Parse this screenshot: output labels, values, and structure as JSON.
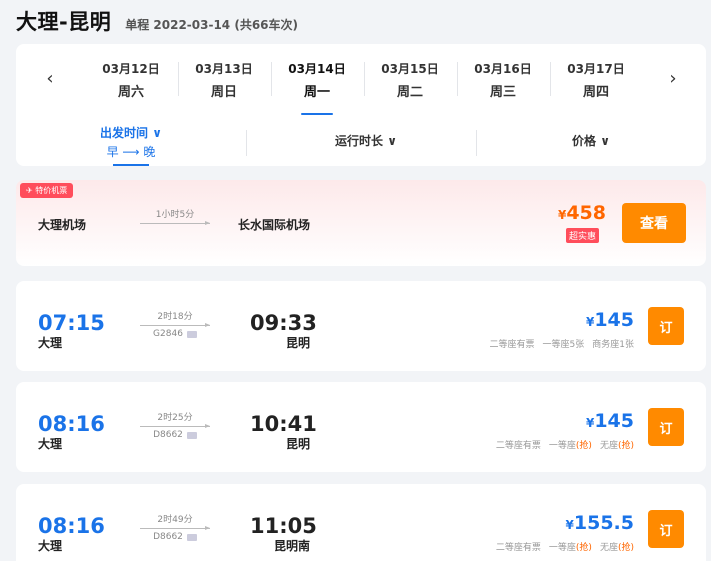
{
  "header": {
    "title": "大理-昆明",
    "subtitle": "单程 2022-03-14 (共66车次)"
  },
  "date_bar": {
    "prev_icon": "chevron-left-icon",
    "next_icon": "chevron-right-icon",
    "dates": [
      {
        "date": "03月12日",
        "weekday": "周六"
      },
      {
        "date": "03月13日",
        "weekday": "周日"
      },
      {
        "date": "03月14日",
        "weekday": "周一",
        "selected": true
      },
      {
        "date": "03月15日",
        "weekday": "周二"
      },
      {
        "date": "03月16日",
        "weekday": "周三"
      },
      {
        "date": "03月17日",
        "weekday": "周四"
      }
    ]
  },
  "sort_bar": {
    "departure": {
      "label": "出发时间 ∨",
      "order": "早 ⟶ 晚"
    },
    "duration": {
      "label": "运行时长 ∨"
    },
    "price": {
      "label": "价格 ∨"
    }
  },
  "flight_card": {
    "badge": "✈ 特价机票",
    "from": "大理机场",
    "duration": "1小时5分",
    "to": "长水国际机场",
    "currency": "¥",
    "price": "458",
    "tag": "超实惠",
    "action": "查看"
  },
  "trains": [
    {
      "depart_time": "07:15",
      "depart_station": "大理",
      "duration": "2时18分",
      "train_no": "G2846",
      "arrive_time": "09:33",
      "arrive_station": "昆明",
      "currency": "¥",
      "price": "145",
      "seats": [
        {
          "text": "二等座有票"
        },
        {
          "text": "一等座5张"
        },
        {
          "text": "商务座1张"
        }
      ],
      "action": "订"
    },
    {
      "depart_time": "08:16",
      "depart_station": "大理",
      "duration": "2时25分",
      "train_no": "D8662",
      "arrive_time": "10:41",
      "arrive_station": "昆明",
      "currency": "¥",
      "price": "145",
      "seats": [
        {
          "text": "二等座有票"
        },
        {
          "text": "一等座",
          "grab": "(抢)"
        },
        {
          "text": "无座",
          "grab": "(抢)"
        }
      ],
      "action": "订"
    },
    {
      "depart_time": "08:16",
      "depart_station": "大理",
      "duration": "2时49分",
      "train_no": "D8662",
      "arrive_time": "11:05",
      "arrive_station": "昆明南",
      "currency": "¥",
      "price": "155.5",
      "seats": [
        {
          "text": "二等座有票"
        },
        {
          "text": "一等座",
          "grab": "(抢)"
        },
        {
          "text": "无座",
          "grab": "(抢)"
        }
      ],
      "action": "订"
    }
  ],
  "colors": {
    "accent": "#1a73e8",
    "orange": "#ff8a00",
    "red": "#ff4d5b"
  }
}
